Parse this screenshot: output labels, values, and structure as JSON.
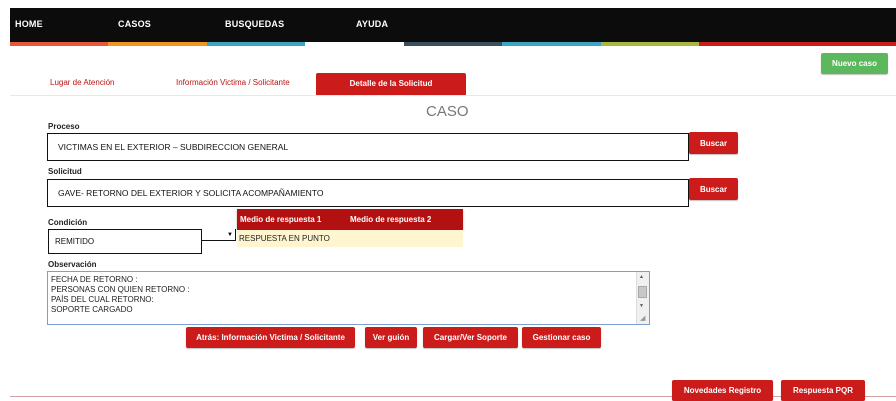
{
  "nav": {
    "items": [
      "HOME",
      "CASOS",
      "BUSQUEDAS",
      "AYUDA"
    ]
  },
  "colors": {
    "stripe": [
      "#e6573c",
      "#f29420",
      "#3aa6c4",
      "#ffffff",
      "#3b4e5c",
      "#3aa6c4",
      "#a8b83a",
      "#cc1b1b",
      "#cc1b1b"
    ],
    "accent": "#cc1b1b",
    "success": "#5cb85c"
  },
  "actions": {
    "nuevo_caso": "Nuevo caso"
  },
  "tabs": [
    "Lugar de Atención",
    "Información Victima / Solicitante",
    "Detalle de la Solicitud"
  ],
  "section_title": "CASO",
  "form": {
    "proceso_label": "Proceso",
    "proceso_value": "VICTIMAS EN EL EXTERIOR – SUBDIRECCION GENERAL",
    "solicitud_label": "Solicitud",
    "solicitud_value": "GAVE- RETORNO DEL EXTERIOR Y SOLICITA ACOMPAÑAMIENTO",
    "buscar": "Buscar",
    "condicion_label": "Condición",
    "condicion_value": "REMITIDO",
    "medio1_header": "Medio de respuesta 1",
    "medio2_header": "Medio de respuesta 2",
    "medio1_value": "RESPUESTA EN PUNTO",
    "observacion_label": "Observación",
    "observacion_value": "FECHA DE RETORNO :\nPERSONAS CON QUIEN RETORNO :\nPAÍS DEL CUAL RETORNO:\nSOPORTE CARGADO"
  },
  "buttons": {
    "atras": "Atrás: Información Victima / Solicitante",
    "ver_guion": "Ver guión",
    "cargar": "Cargar/Ver Soporte",
    "gestionar": "Gestionar caso",
    "novedades": "Novedades Registro",
    "pqr": "Respuesta PQR"
  }
}
